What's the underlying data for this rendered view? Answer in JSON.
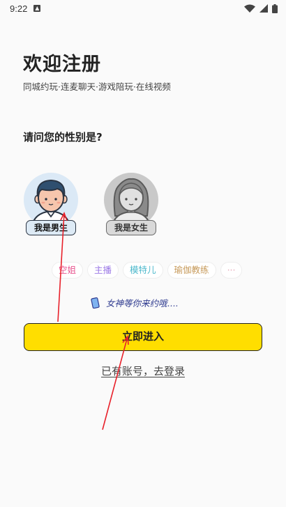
{
  "status_bar": {
    "time": "9:22",
    "icons": [
      "notification-app-icon",
      "wifi-icon",
      "signal-icon",
      "battery-icon"
    ]
  },
  "header": {
    "title": "欢迎注册",
    "subtitle": "同城约玩·连麦聊天·游戏陪玩·在线视频"
  },
  "question": "请问您的性别是?",
  "gender_options": {
    "male": {
      "label": "我是男生",
      "icon": "male-avatar-icon"
    },
    "female": {
      "label": "我是女生",
      "icon": "female-avatar-icon"
    }
  },
  "tags": [
    {
      "label": "空姐",
      "color": "#e8558f"
    },
    {
      "label": "主播",
      "color": "#9b78e6"
    },
    {
      "label": "模特儿",
      "color": "#4eb9cc"
    },
    {
      "label": "瑜伽教练",
      "color": "#c79a5a"
    },
    {
      "label": "···",
      "color": "#e7a7b8"
    }
  ],
  "tagline": {
    "icon": "phone-icon",
    "text": "女神等你来约哦...."
  },
  "enter_button": {
    "label": "立即进入",
    "color": "#ffde00"
  },
  "login_link": "已有账号，去登录",
  "colors": {
    "accent": "#ffde00",
    "annotation": "#e8202a"
  }
}
